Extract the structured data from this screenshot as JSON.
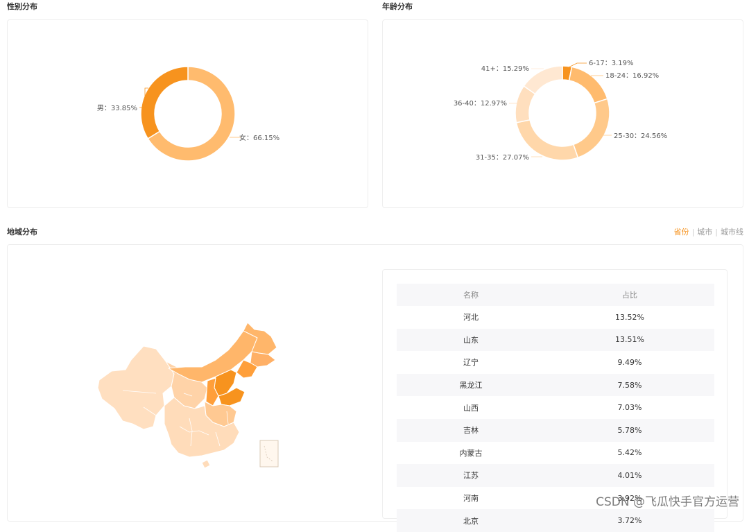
{
  "gender": {
    "title": "性别分布",
    "labels": [
      "男：33.85%",
      "女：66.15%"
    ],
    "slices": [
      {
        "name": "男",
        "percent": 33.85,
        "color": "#f7931e"
      },
      {
        "name": "女",
        "percent": 66.15,
        "color": "#ffbb6e"
      }
    ]
  },
  "age": {
    "title": "年龄分布",
    "labels": [
      "6-17：3.19%",
      "18-24：16.92%",
      "25-30：24.56%",
      "31-35：27.07%",
      "36-40：12.97%",
      "41+：15.29%"
    ],
    "slices": [
      {
        "name": "6-17",
        "percent": 3.19,
        "color": "#f7931e"
      },
      {
        "name": "18-24",
        "percent": 16.92,
        "color": "#ffbb6e"
      },
      {
        "name": "25-30",
        "percent": 24.56,
        "color": "#ffc98a"
      },
      {
        "name": "31-35",
        "percent": 27.07,
        "color": "#ffd7aa"
      },
      {
        "name": "36-40",
        "percent": 12.97,
        "color": "#ffdfbe"
      },
      {
        "name": "41+",
        "percent": 15.29,
        "color": "#ffe8d2"
      }
    ]
  },
  "region": {
    "title": "地域分布",
    "tabs": [
      "省份",
      "城市",
      "城市线"
    ],
    "active_tab": "省份",
    "table": {
      "headers": [
        "名称",
        "占比"
      ],
      "rows": [
        [
          "河北",
          "13.52%"
        ],
        [
          "山东",
          "13.51%"
        ],
        [
          "辽宁",
          "9.49%"
        ],
        [
          "黑龙江",
          "7.58%"
        ],
        [
          "山西",
          "7.03%"
        ],
        [
          "吉林",
          "5.78%"
        ],
        [
          "内蒙古",
          "5.42%"
        ],
        [
          "江苏",
          "4.01%"
        ],
        [
          "河南",
          "3.92%"
        ],
        [
          "北京",
          "3.72%"
        ]
      ]
    }
  },
  "watermark": "CSDN @飞瓜快手官方运营"
}
